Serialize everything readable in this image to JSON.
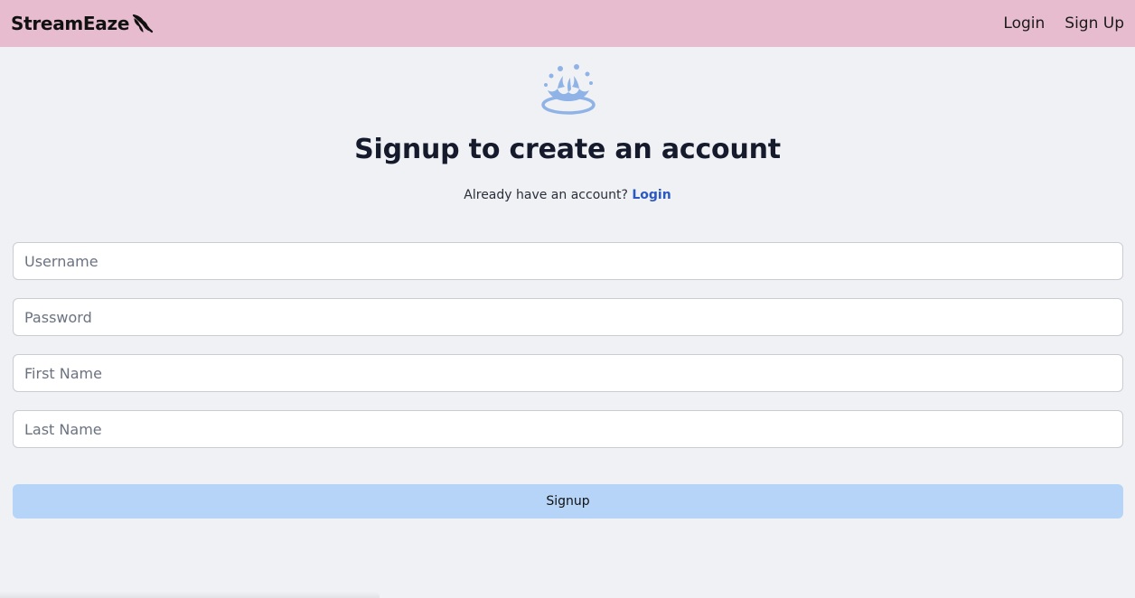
{
  "brand": {
    "name": "StreamEaze",
    "icon": "feather-wing-icon"
  },
  "nav": {
    "login_label": "Login",
    "signup_label": "Sign Up"
  },
  "hero": {
    "icon": "water-splash-icon",
    "icon_color": "#8fb3e6",
    "title": "Signup to create an account",
    "prompt_text": "Already have an account?",
    "login_link": "Login"
  },
  "form": {
    "username_placeholder": "Username",
    "username_value": "",
    "password_placeholder": "Password",
    "password_value": "",
    "first_name_placeholder": "First Name",
    "first_name_value": "",
    "last_name_placeholder": "Last Name",
    "last_name_value": "",
    "submit_label": "Signup"
  },
  "colors": {
    "navbar_bg": "#e8bccf",
    "page_bg": "#f0f1f5",
    "button_bg": "#b5d4f8",
    "link": "#2b59c3",
    "heading": "#151b2c"
  }
}
